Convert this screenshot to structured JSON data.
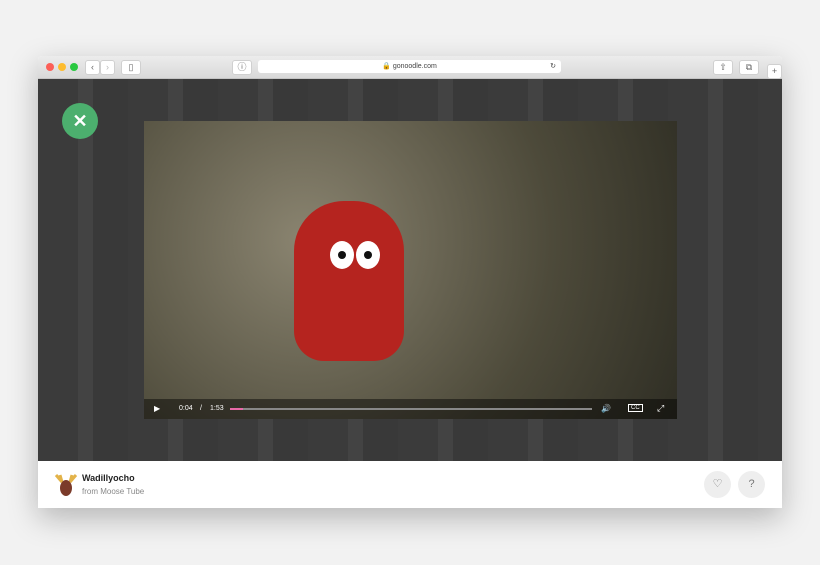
{
  "browser": {
    "url": "gonoodle.com",
    "back_icon": "chevron-left-icon",
    "forward_icon": "chevron-right-icon"
  },
  "player": {
    "close_icon": "close-icon",
    "current_time": "0:04",
    "separator": "/",
    "duration": "1:53",
    "progress_percent": 3.5,
    "accent": "#e86aa8",
    "close_color": "#4caf6e"
  },
  "footer": {
    "title": "Wadillyocho",
    "subtitle": "from Moose Tube",
    "favorite_icon": "heart-icon",
    "help_label": "?"
  }
}
